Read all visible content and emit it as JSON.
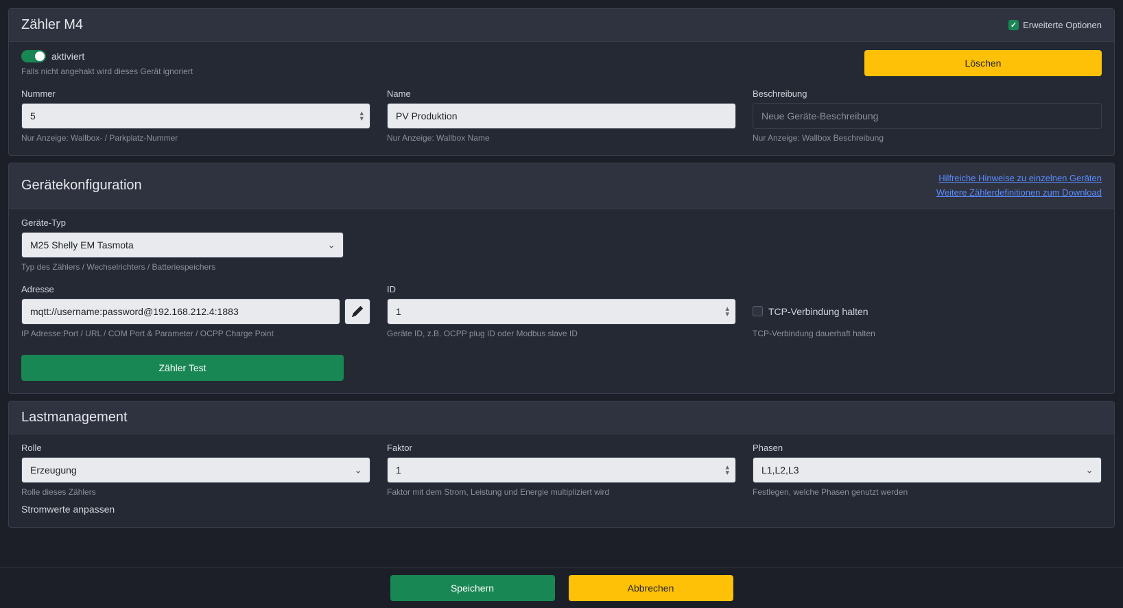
{
  "header": {
    "title": "Zähler M4",
    "advanced_label": "Erweiterte Optionen"
  },
  "activation": {
    "label": "aktiviert",
    "help": "Falls nicht angehakt wird dieses Gerät ignoriert",
    "delete_label": "Löschen"
  },
  "basic": {
    "number_label": "Nummer",
    "number_value": "5",
    "number_help": "Nur Anzeige: Wallbox- / Parkplatz-Nummer",
    "name_label": "Name",
    "name_value": "PV Produktion",
    "name_help": "Nur Anzeige: Wallbox Name",
    "desc_label": "Beschreibung",
    "desc_placeholder": "Neue Geräte-Beschreibung",
    "desc_help": "Nur Anzeige: Wallbox Beschreibung"
  },
  "device_config": {
    "title": "Gerätekonfiguration",
    "link1": "Hilfreiche Hinweise zu einzelnen Geräten",
    "link2": "Weitere Zählerdefinitionen zum Download",
    "type_label": "Geräte-Typ",
    "type_value": "M25 Shelly EM Tasmota",
    "type_help": "Typ des Zählers / Wechselrichters / Batteriespeichers",
    "addr_label": "Adresse",
    "addr_value": "mqtt://username:password@192.168.212.4:1883",
    "addr_help": "IP Adresse:Port / URL / COM Port & Parameter / OCPP Charge Point",
    "id_label": "ID",
    "id_value": "1",
    "id_help": "Geräte ID, z.B. OCPP plug ID oder Modbus slave ID",
    "tcp_label": "TCP-Verbindung halten",
    "tcp_help": "TCP-Verbindung dauerhaft halten",
    "test_label": "Zähler Test"
  },
  "load_mgmt": {
    "title": "Lastmanagement",
    "role_label": "Rolle",
    "role_value": "Erzeugung",
    "role_help": "Rolle dieses Zählers",
    "factor_label": "Faktor",
    "factor_value": "1",
    "factor_help": "Faktor mit dem Strom, Leistung und Energie multipliziert wird",
    "phases_label": "Phasen",
    "phases_value": "L1,L2,L3",
    "phases_help": "Festlegen, welche Phasen genutzt werden",
    "adjust_label": "Stromwerte anpassen"
  },
  "footer": {
    "save": "Speichern",
    "cancel": "Abbrechen"
  }
}
